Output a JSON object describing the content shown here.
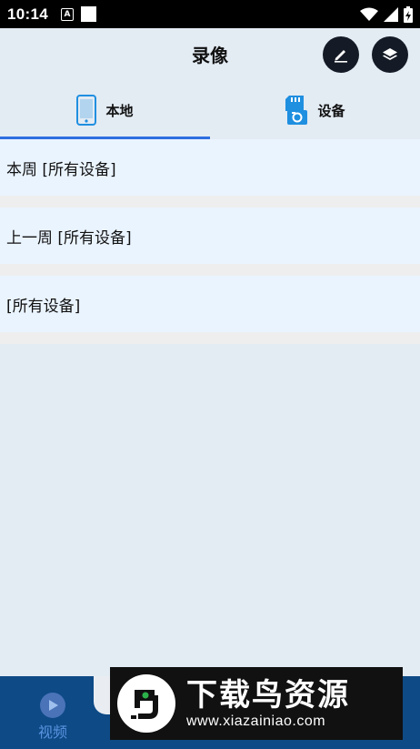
{
  "status_bar": {
    "time": "10:14",
    "notification_letter": "A"
  },
  "header": {
    "title": "录像"
  },
  "tabs": [
    {
      "label": "本地",
      "icon": "phone-icon",
      "active": true
    },
    {
      "label": "设备",
      "icon": "sd-card-camera-icon",
      "active": false
    }
  ],
  "recordings": [
    {
      "label": "本周 [所有设备]"
    },
    {
      "label": "上一周  [所有设备]"
    },
    {
      "label": "[所有设备]"
    }
  ],
  "bottom_nav": {
    "item_label": "视频"
  },
  "watermark": {
    "text": "下载鸟资源",
    "url": "www.xiazainiao.com"
  },
  "colors": {
    "accent": "#2f6ee0",
    "header_button": "#151b26",
    "bottom_bar": "#0e4a86",
    "row_bg": "#eaf4ff"
  }
}
